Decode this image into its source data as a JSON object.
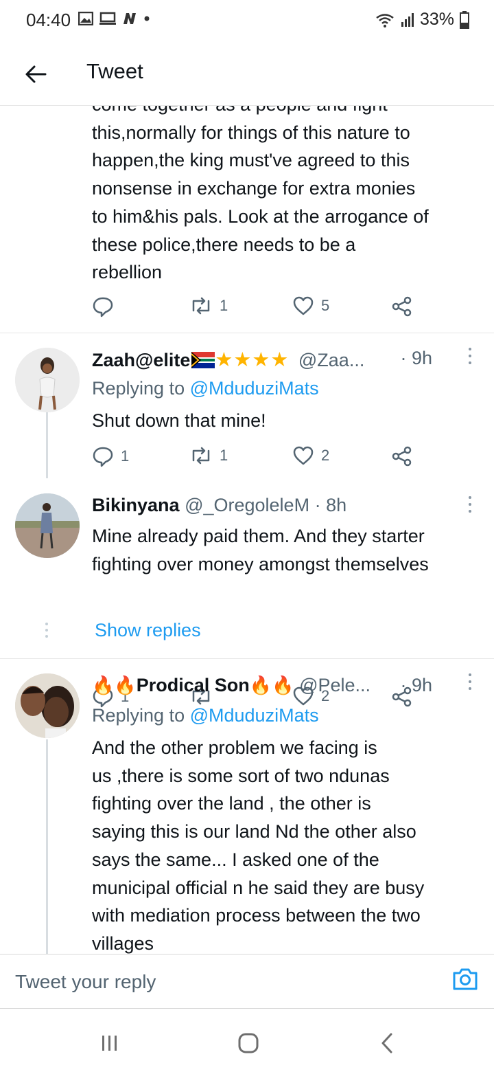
{
  "status_bar": {
    "time": "04:40",
    "battery": "33%"
  },
  "header": {
    "title": "Tweet"
  },
  "parent_tweet": {
    "text_lines": [
      "come together as a people and fight",
      "this,normally for things of this nature to",
      "happen,the king must've agreed to this",
      "nonsense in exchange for extra monies",
      "to him&his pals. Look at the arrogance of",
      "these police,there needs to be a",
      "rebellion"
    ],
    "retweets": "1",
    "likes": "5"
  },
  "replies": [
    {
      "name": "Zaah@elite",
      "handle": "@Zaa...",
      "time": "· 9h",
      "replying_label": "Replying to",
      "replying_to": "@MduduziMats",
      "text": "Shut down that mine!",
      "reply_count": "1",
      "retweets": "1",
      "likes": "2"
    },
    {
      "name": "Bikinyana",
      "handle": "@_OregoleleM",
      "time": "· 8h",
      "text_lines": [
        "Mine already paid them. And they starter",
        "fighting over money amongst themselves"
      ],
      "reply_count": "1",
      "retweets": "",
      "likes": "2",
      "show_replies": "Show replies"
    },
    {
      "name": "Prodical Son",
      "handle": "@Pele...",
      "time": "· 9h",
      "replying_label": "Replying to",
      "replying_to": "@MduduziMats",
      "text_lines": [
        "And the other problem we facing is",
        "us ,there is some sort of two ndunas",
        "fighting over the land , the other is",
        "saying this is our land Nd the other also",
        "says the same... I asked one of the",
        "municipal official n he said they are busy",
        "with mediation process between the two",
        "villages"
      ]
    }
  ],
  "composer": {
    "placeholder": "Tweet your reply"
  },
  "icons": {
    "back": "arrow-left-icon",
    "reply": "speech-bubble-icon",
    "retweet": "retweet-icon",
    "like": "heart-icon",
    "share": "share-icon",
    "camera": "camera-icon",
    "more": "vertical-dots-icon"
  },
  "colors": {
    "accent": "#1d9bf0",
    "muted": "#536471",
    "star": "#ffb400",
    "fire": "#f5a623"
  }
}
